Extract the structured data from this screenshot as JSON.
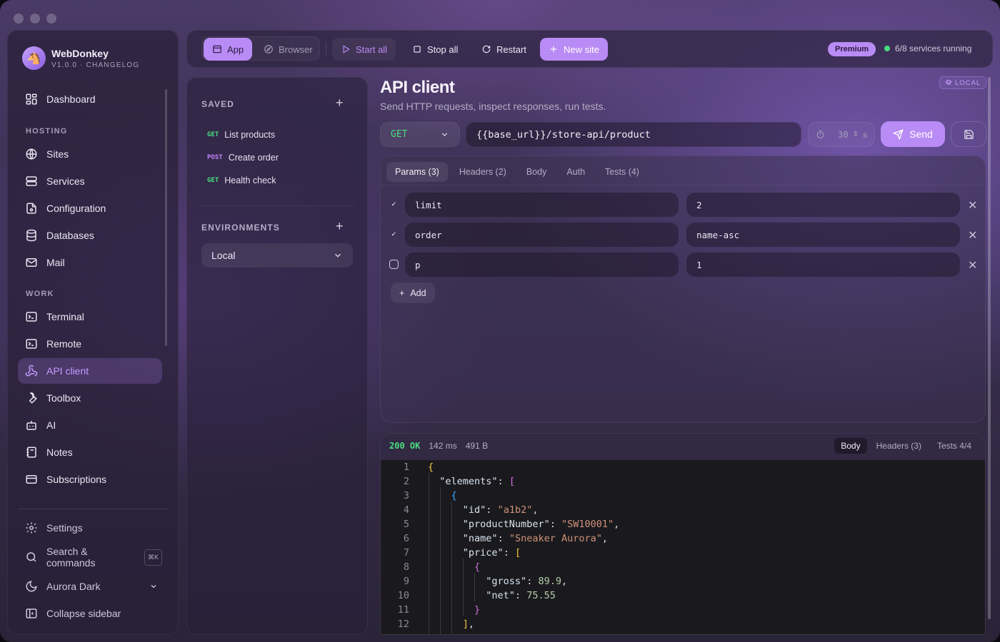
{
  "brand": {
    "name": "WebDonkey",
    "version": "V1.0.0 · CHANGELOG"
  },
  "sidebar": {
    "top": [
      {
        "label": "Dashboard",
        "icon": "dashboard-icon"
      }
    ],
    "hosting_label": "HOSTING",
    "hosting": [
      {
        "label": "Sites",
        "icon": "globe-icon"
      },
      {
        "label": "Services",
        "icon": "server-icon"
      },
      {
        "label": "Configuration",
        "icon": "config-file-icon"
      },
      {
        "label": "Databases",
        "icon": "database-icon"
      },
      {
        "label": "Mail",
        "icon": "mail-icon"
      }
    ],
    "work_label": "WORK",
    "work": [
      {
        "label": "Terminal",
        "icon": "terminal-icon"
      },
      {
        "label": "Remote",
        "icon": "remote-terminal-icon"
      },
      {
        "label": "API client",
        "icon": "api-webhook-icon",
        "active": true
      },
      {
        "label": "Toolbox",
        "icon": "wrench-icon"
      },
      {
        "label": "AI",
        "icon": "bot-icon"
      },
      {
        "label": "Notes",
        "icon": "notebook-icon"
      },
      {
        "label": "Subscriptions",
        "icon": "credit-card-icon"
      }
    ],
    "bottom": {
      "settings": "Settings",
      "search": "Search & commands",
      "search_kbd": "⌘K",
      "theme": "Aurora Dark",
      "collapse": "Collapse sidebar"
    }
  },
  "toolbar": {
    "app": "App",
    "browser": "Browser",
    "start_all": "Start all",
    "stop_all": "Stop all",
    "restart": "Restart",
    "new_site": "New site",
    "premium": "Premium",
    "status": "6/8 services running"
  },
  "saved": {
    "label": "SAVED",
    "requests": [
      {
        "method": "GET",
        "name": "List products"
      },
      {
        "method": "POST",
        "name": "Create order"
      },
      {
        "method": "GET",
        "name": "Health check"
      }
    ],
    "env_label": "ENVIRONMENTS",
    "env_selected": "Local"
  },
  "main": {
    "title": "API client",
    "subtitle": "Send HTTP requests, inspect responses, run tests.",
    "badge": "LOCAL",
    "method": "GET",
    "url": "{{base_url}}/store-api/product",
    "timeout": "30",
    "timeout_unit": "s",
    "send": "Send",
    "tabs": [
      "Params (3)",
      "Headers (2)",
      "Body",
      "Auth",
      "Tests (4)"
    ],
    "params": [
      {
        "key": "limit",
        "value": "2",
        "enabled": true
      },
      {
        "key": "order",
        "value": "name-asc",
        "enabled": true
      },
      {
        "key": "p",
        "value": "1",
        "enabled": false
      }
    ],
    "add": "Add"
  },
  "response": {
    "status": "200 OK",
    "time": "142 ms",
    "size": "491 B",
    "tabs": [
      "Body",
      "Headers (3)",
      "Tests 4/4"
    ]
  },
  "colors": {
    "accent": "#b98bf5",
    "success": "#4ade80",
    "post": "#c084fc"
  }
}
